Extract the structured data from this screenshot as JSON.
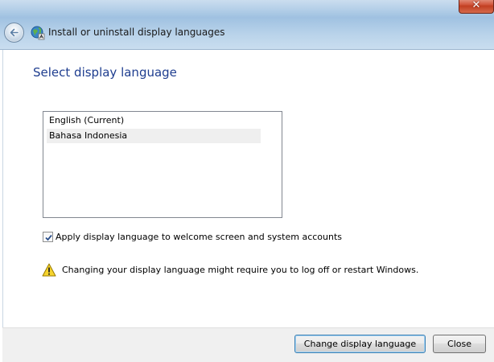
{
  "window": {
    "title": "Install or uninstall display languages",
    "close_glyph": "✕"
  },
  "page": {
    "heading": "Select display language"
  },
  "languages": [
    {
      "label": "English (Current)"
    },
    {
      "label": "Bahasa Indonesia"
    }
  ],
  "options": {
    "apply_checkbox_label": "Apply display language to welcome screen and system accounts",
    "apply_checked": true
  },
  "warning": {
    "text": "Changing your display language might require you to log off or restart Windows.",
    "icon": "warning-icon"
  },
  "buttons": {
    "change_label": "Change display language",
    "close_label": "Close"
  },
  "colors": {
    "heading": "#1e3d8f",
    "titlebar": "#9fc1e1",
    "close_button": "#c23f22"
  }
}
